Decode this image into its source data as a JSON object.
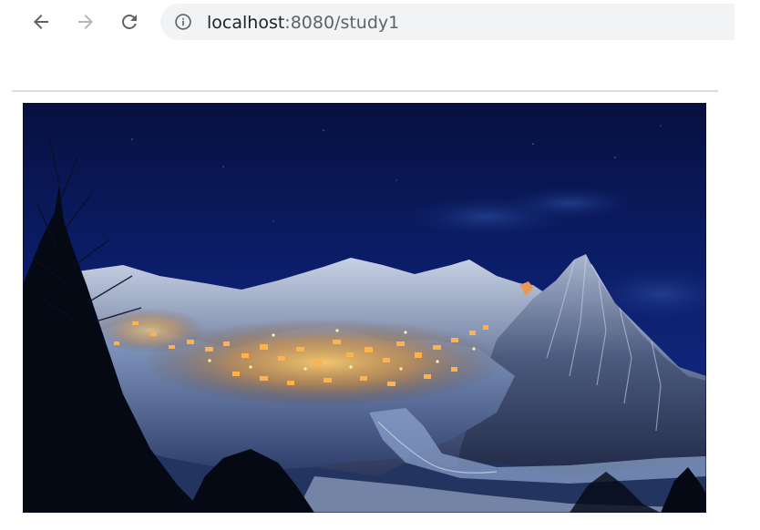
{
  "browser": {
    "back_icon": "arrow-left-icon",
    "forward_icon": "arrow-right-icon",
    "reload_icon": "reload-icon",
    "info_icon": "info-icon",
    "address": {
      "host": "localhost",
      "rest": ":8080/study1"
    }
  },
  "page": {
    "image": {
      "subject": "night-mountain-village-photo"
    }
  },
  "colors": {
    "omnibox_bg": "#f1f3f4",
    "host_text": "#202124",
    "path_text": "#5f6368",
    "disabled_icon": "#b4b7bb",
    "divider": "#dadce0"
  }
}
